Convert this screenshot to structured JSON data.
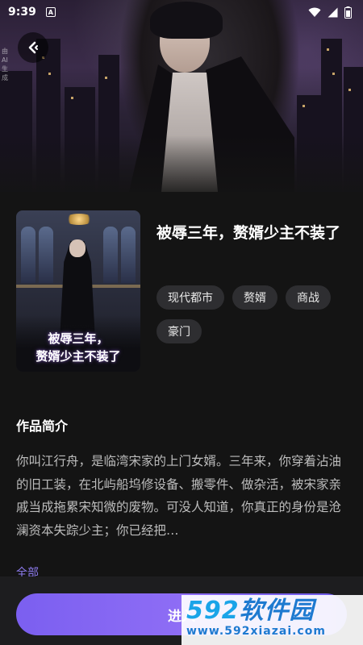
{
  "status_bar": {
    "time": "9:39",
    "indicator": "A"
  },
  "hero": {
    "ai_label": "由AI生成"
  },
  "book": {
    "title": "被辱三年，赘婿少主不装了",
    "cover_title_line1": "被辱三年，",
    "cover_title_line2": "赘婿少主不装了",
    "tags": [
      "现代都市",
      "赘婿",
      "商战",
      "豪门"
    ]
  },
  "synopsis": {
    "heading": "作品简介",
    "text": "你叫江行舟，是临湾宋家的上门女婿。三年来，你穿着沾油的旧工装，在北屿船坞修设备、搬零件、做杂活，被宋家亲戚当成拖累宋知微的废物。可没人知道，你真正的身份是沧澜资本失踪少主；你已经把…",
    "more_label": "全部"
  },
  "bottom": {
    "enter_label": "进入"
  },
  "watermark": {
    "brand_num": "592",
    "brand_txt": "软件园",
    "url": "www.592xiazai.com"
  },
  "colors": {
    "accent": "#8e6df5",
    "link": "#8e7cf0",
    "tag_bg": "#2e2e31",
    "background": "#141414"
  }
}
